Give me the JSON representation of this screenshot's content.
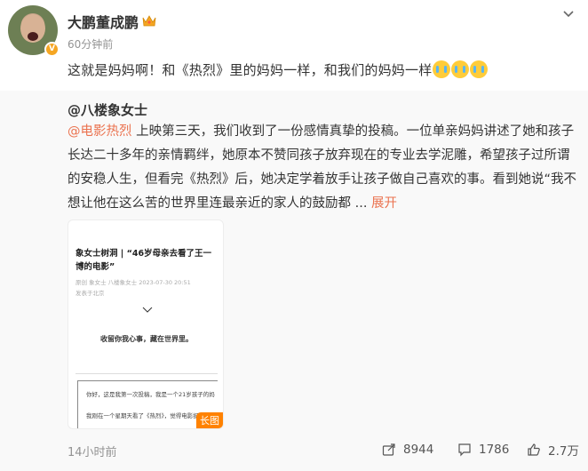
{
  "post": {
    "username": "大鹏董成鹏",
    "time": "60分钟前",
    "text": "这就是妈妈啊！和《热烈》里的妈妈一样，和我们的妈妈一样",
    "emoji_icon": "crying-face-icon",
    "emoji_count": 3
  },
  "repost": {
    "author": "@八楼象女士",
    "link_text": "@电影热烈",
    "body": " 上映第三天，我们收到了一份感情真挚的投稿。一位单亲妈妈讲述了她和孩子长达二十多年的亲情羁绊，她原本不赞同孩子放弃现在的专业去学泥雕，希望孩子过所谓的安稳人生，但看完《热烈》后，她决定学着放手让孩子做自己喜欢的事。看到她说“我不想让他在这么苦的世界里连最亲近的家人的鼓励都 ",
    "ellipsis": "...",
    "expand": "展开",
    "card": {
      "title": "象女士树洞 | “46岁母亲去看了王一博的电影”",
      "meta": "原创  象女士  八楼象女士   2023-07-30 20:51",
      "meta2": "发表于北京",
      "quote": "收留你我心事，藏在世界里。",
      "text1": "你好，这是我第一次投稿，我是一个21岁孩子的妈",
      "text2": "我刚在一个星期天看了《热烈》，觉得电影挺好",
      "badge": "长图"
    },
    "time": "14小时前",
    "shares": "8944",
    "comments": "1786",
    "likes": "2.7万"
  },
  "colors": {
    "link": "#eb7350",
    "repost_bg": "#f9f9f9",
    "badge": "#ff8200"
  }
}
